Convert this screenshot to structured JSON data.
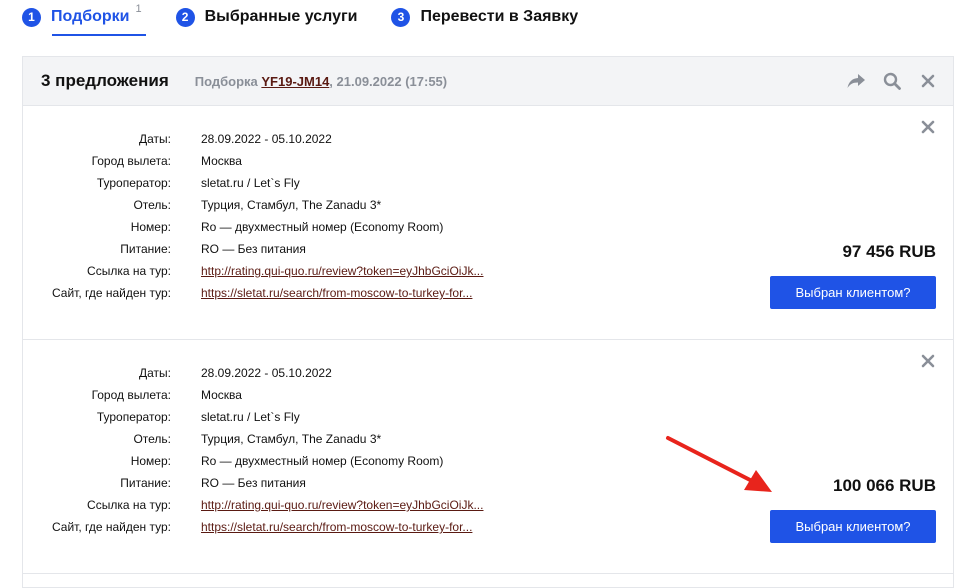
{
  "steps": [
    {
      "num": "1",
      "label": "Подборки",
      "sup": "1",
      "active": true
    },
    {
      "num": "2",
      "label": "Выбранные услуги"
    },
    {
      "num": "3",
      "label": "Перевести в Заявку"
    }
  ],
  "panel": {
    "title": "3 предложения",
    "selection_prefix": "Подборка",
    "selection_code": "YF19-JM14",
    "selection_date": ", 21.09.2022 (17:55)",
    "icons": [
      "share-icon",
      "search-icon",
      "close-icon"
    ]
  },
  "offers": [
    {
      "fields": [
        {
          "k": "Даты:",
          "v": "28.09.2022 - 05.10.2022"
        },
        {
          "k": "Город вылета:",
          "v": "Москва"
        },
        {
          "k": "Туроператор:",
          "v": "sletat.ru / Let`s Fly"
        },
        {
          "k": "Отель:",
          "v": "Турция, Стамбул, The Zanadu 3*"
        },
        {
          "k": "Номер:",
          "v": "Ro — двухместный номер (Economy Room)"
        },
        {
          "k": "Питание:",
          "v": "RO — Без питания"
        },
        {
          "k": "Ссылка на тур:",
          "v": "http://rating.qui-quo.ru/review?token=eyJhbGciOiJk..."
        },
        {
          "k": "Сайт, где найден тур:",
          "v": "https://sletat.ru/search/from-moscow-to-turkey-for..."
        }
      ],
      "price": "97 456 RUB",
      "button": "Выбран клиентом?"
    },
    {
      "fields": [
        {
          "k": "Даты:",
          "v": "28.09.2022 - 05.10.2022"
        },
        {
          "k": "Город вылета:",
          "v": "Москва"
        },
        {
          "k": "Туроператор:",
          "v": "sletat.ru / Let`s Fly"
        },
        {
          "k": "Отель:",
          "v": "Турция, Стамбул, The Zanadu 3*"
        },
        {
          "k": "Номер:",
          "v": "Ro — двухместный номер (Economy Room)"
        },
        {
          "k": "Питание:",
          "v": "RO — Без питания"
        },
        {
          "k": "Ссылка на тур:",
          "v": "http://rating.qui-quo.ru/review?token=eyJhbGciOiJk..."
        },
        {
          "k": "Сайт, где найден тур:",
          "v": "https://sletat.ru/search/from-moscow-to-turkey-for..."
        }
      ],
      "price": "100 066 RUB",
      "button": "Выбран клиентом?"
    }
  ],
  "colors": {
    "accent": "#1f53e6",
    "link": "#5a1a12",
    "arrow": "#e8241c"
  }
}
